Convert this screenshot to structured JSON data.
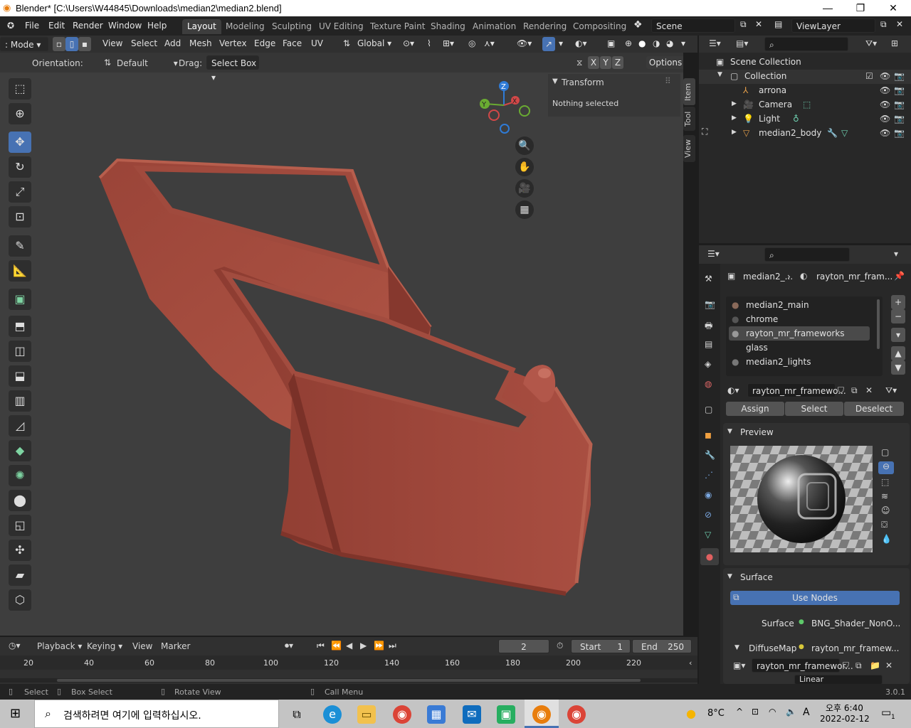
{
  "window": {
    "title": "Blender* [C:\\Users\\W44845\\Downloads\\median2\\median2.blend]",
    "minimize": "—",
    "maximize": "❐",
    "close": "✕"
  },
  "menu": {
    "file": "File",
    "edit": "Edit",
    "render": "Render",
    "window": "Window",
    "help": "Help"
  },
  "workspaces": [
    "Layout",
    "Modeling",
    "Sculpting",
    "UV Editing",
    "Texture Paint",
    "Shading",
    "Animation",
    "Rendering",
    "Compositing"
  ],
  "scene": {
    "name": "Scene",
    "view_layer": "ViewLayer"
  },
  "viewport_header": {
    "mode": ": Mode",
    "view": "View",
    "select": "Select",
    "add": "Add",
    "mesh": "Mesh",
    "vertex": "Vertex",
    "edge": "Edge",
    "face": "Face",
    "uv": "UV",
    "transform_orientation": "Global"
  },
  "tool_header": {
    "orientation_label": "Orientation:",
    "orientation_value": "Default",
    "drag_label": "Drag:",
    "drag_value": "Select Box",
    "axis_x": "X",
    "axis_y": "Y",
    "axis_z": "Z",
    "options": "Options"
  },
  "n_panel": {
    "section": "Transform",
    "message": "Nothing selected",
    "tabs": [
      "Item",
      "Tool",
      "View"
    ]
  },
  "outliner": {
    "root": "Scene Collection",
    "collection": "Collection",
    "items": [
      {
        "name": "arrona",
        "icon": "armature-icon"
      },
      {
        "name": "Camera",
        "icon": "camera-icon"
      },
      {
        "name": "Light",
        "icon": "light-icon"
      },
      {
        "name": "median2_body",
        "icon": "mesh-icon"
      }
    ]
  },
  "properties": {
    "breadcrumb_object": "median2_...",
    "breadcrumb_material": "rayton_mr_fram...",
    "material_slots": [
      "median2_main",
      "chrome",
      "rayton_mr_frameworks",
      "glass",
      "median2_lights"
    ],
    "selected_slot": "rayton_mr_frameworks",
    "material_name": "rayton_mr_framewo...",
    "assign": "Assign",
    "select": "Select",
    "deselect": "Deselect",
    "preview_label": "Preview",
    "surface_section": "Surface",
    "use_nodes": "Use Nodes",
    "surface_label": "Surface",
    "surface_value": "BNG_Shader_NonO...",
    "diffuse_label": "DiffuseMap",
    "diffuse_value": "rayton_mr_framew...",
    "image_name": "rayton_mr_framewor...",
    "interpolation": "Linear"
  },
  "timeline": {
    "playback": "Playback",
    "keying": "Keying",
    "view": "View",
    "marker": "Marker",
    "current_frame": "2",
    "start_label": "Start",
    "start": "1",
    "end_label": "End",
    "end": "250",
    "ticks": [
      "20",
      "40",
      "60",
      "80",
      "100",
      "120",
      "140",
      "160",
      "180",
      "200",
      "220"
    ]
  },
  "statusbar": {
    "select": "Select",
    "box_select": "Box Select",
    "rotate_view": "Rotate View",
    "call_menu": "Call Menu",
    "version": "3.0.1"
  },
  "taskbar": {
    "search_placeholder": "검색하려면 여기에 입력하십시오.",
    "weather": "8°C",
    "time": "오후 6:40",
    "date": "2022-02-12",
    "ime": "A",
    "notification_count": "1"
  },
  "colors": {
    "accent": "#4772b3",
    "mesh": "#a24a3e",
    "viewport_bg": "#3e3e3e"
  }
}
